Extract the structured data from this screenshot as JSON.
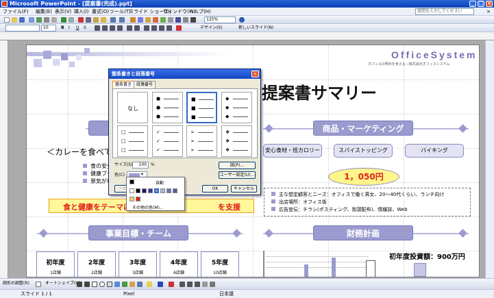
{
  "window": {
    "title": "Microsoft PowerPoint - [提案書(完成).ppt]",
    "controls": [
      "_",
      "□",
      "×"
    ]
  },
  "menu": {
    "items": [
      "ファイル(F)",
      "編集(E)",
      "表示(V)",
      "挿入(I)",
      "書式(O)",
      "ツール(T)",
      "スライド ショー(D)",
      "ウィンドウ(W)",
      "ヘルプ(H)"
    ],
    "help_placeholder": "質問を入力してください",
    "doc_close": "×"
  },
  "toolbar": {
    "zoom": "125%",
    "font_size": "10",
    "bold": "B",
    "italic": "I",
    "underline": "U",
    "strike": "S",
    "design_label": "デザイン(S)",
    "new_slide_label": "新しいスライド(N)"
  },
  "slide": {
    "logo_text": "OfficeSystem",
    "logo_subtext": "オフィスの明日を考える—株式会社オフィスシステム",
    "main_title": "提案書サマリー",
    "left_heading_partial": "＜カレーを食べて、",
    "left_bullets": [
      "食の安全",
      "健康ブー",
      "景気がい"
    ],
    "slogan": "食と健康をテーマに",
    "slogan_tail": "を支援",
    "right_section_title": "商品・マーケティング",
    "tags": [
      "安心食材・低カロリー",
      "スパイストッピング",
      "バイキング"
    ],
    "price": "1，050円",
    "right_bullets": [
      "主な想定顧客とニーズ：オフィスで働く男女、20～40代くらい、ランチ向け",
      "出店場所：オフィス街",
      "広告宣伝：チラシ(ポスティング、街頭配布)、情報誌、Web"
    ],
    "bottom_left_title": "事業目標・チーム",
    "years": [
      {
        "year": "初年度",
        "stores": "1店舗"
      },
      {
        "year": "2年度",
        "stores": "2店舗"
      },
      {
        "year": "3年度",
        "stores": "3店舗"
      },
      {
        "year": "4年度",
        "stores": "6店舗"
      },
      {
        "year": "5年度",
        "stores": "10店舗"
      }
    ],
    "bottom_right_title": "財務計画",
    "investment": "初年度投資額：900万円"
  },
  "dialog": {
    "title": "箇条書きと段落番号",
    "close": "×",
    "tabs": [
      "箇条書き",
      "段落番号"
    ],
    "none_label": "なし",
    "size_label": "サイズ(S):",
    "size_value": "100",
    "size_unit": "%",
    "color_label": "色(C):",
    "figure_button": "図(P)...",
    "user_button": "ユーザー設定(U)...",
    "reset_button": "リセット",
    "ok_button": "OK",
    "cancel_button": "キャンセル"
  },
  "color_popup": {
    "auto_label": "自動",
    "more_label": "その他の色(M)..."
  },
  "drawbar": {
    "draw_label": "図形の調整(R)",
    "autoshape_label": "オートシェイプ(U)"
  },
  "status": {
    "slide_info": "スライド 1 / 1",
    "design": "Pixel",
    "language": "日本語"
  },
  "colors": {
    "accent": "#9b9bd0",
    "slogan_bg": "#fff799",
    "slogan_text": "#e0221a",
    "price_bg": "#fff58a",
    "price_text": "#e0221a"
  }
}
